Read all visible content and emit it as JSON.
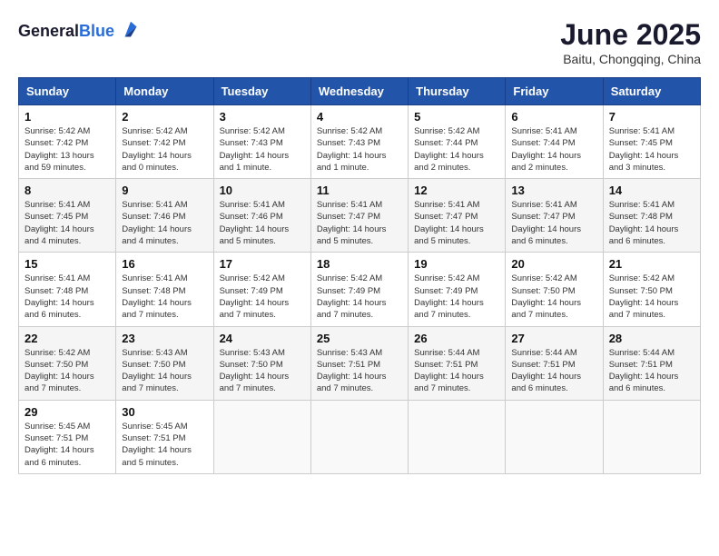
{
  "header": {
    "logo_general": "General",
    "logo_blue": "Blue",
    "month": "June 2025",
    "location": "Baitu, Chongqing, China"
  },
  "weekdays": [
    "Sunday",
    "Monday",
    "Tuesday",
    "Wednesday",
    "Thursday",
    "Friday",
    "Saturday"
  ],
  "weeks": [
    [
      {
        "day": "1",
        "sunrise": "5:42 AM",
        "sunset": "7:42 PM",
        "daylight": "13 hours and 59 minutes."
      },
      {
        "day": "2",
        "sunrise": "5:42 AM",
        "sunset": "7:42 PM",
        "daylight": "14 hours and 0 minutes."
      },
      {
        "day": "3",
        "sunrise": "5:42 AM",
        "sunset": "7:43 PM",
        "daylight": "14 hours and 1 minute."
      },
      {
        "day": "4",
        "sunrise": "5:42 AM",
        "sunset": "7:43 PM",
        "daylight": "14 hours and 1 minute."
      },
      {
        "day": "5",
        "sunrise": "5:42 AM",
        "sunset": "7:44 PM",
        "daylight": "14 hours and 2 minutes."
      },
      {
        "day": "6",
        "sunrise": "5:41 AM",
        "sunset": "7:44 PM",
        "daylight": "14 hours and 2 minutes."
      },
      {
        "day": "7",
        "sunrise": "5:41 AM",
        "sunset": "7:45 PM",
        "daylight": "14 hours and 3 minutes."
      }
    ],
    [
      {
        "day": "8",
        "sunrise": "5:41 AM",
        "sunset": "7:45 PM",
        "daylight": "14 hours and 4 minutes."
      },
      {
        "day": "9",
        "sunrise": "5:41 AM",
        "sunset": "7:46 PM",
        "daylight": "14 hours and 4 minutes."
      },
      {
        "day": "10",
        "sunrise": "5:41 AM",
        "sunset": "7:46 PM",
        "daylight": "14 hours and 5 minutes."
      },
      {
        "day": "11",
        "sunrise": "5:41 AM",
        "sunset": "7:47 PM",
        "daylight": "14 hours and 5 minutes."
      },
      {
        "day": "12",
        "sunrise": "5:41 AM",
        "sunset": "7:47 PM",
        "daylight": "14 hours and 5 minutes."
      },
      {
        "day": "13",
        "sunrise": "5:41 AM",
        "sunset": "7:47 PM",
        "daylight": "14 hours and 6 minutes."
      },
      {
        "day": "14",
        "sunrise": "5:41 AM",
        "sunset": "7:48 PM",
        "daylight": "14 hours and 6 minutes."
      }
    ],
    [
      {
        "day": "15",
        "sunrise": "5:41 AM",
        "sunset": "7:48 PM",
        "daylight": "14 hours and 6 minutes."
      },
      {
        "day": "16",
        "sunrise": "5:41 AM",
        "sunset": "7:48 PM",
        "daylight": "14 hours and 7 minutes."
      },
      {
        "day": "17",
        "sunrise": "5:42 AM",
        "sunset": "7:49 PM",
        "daylight": "14 hours and 7 minutes."
      },
      {
        "day": "18",
        "sunrise": "5:42 AM",
        "sunset": "7:49 PM",
        "daylight": "14 hours and 7 minutes."
      },
      {
        "day": "19",
        "sunrise": "5:42 AM",
        "sunset": "7:49 PM",
        "daylight": "14 hours and 7 minutes."
      },
      {
        "day": "20",
        "sunrise": "5:42 AM",
        "sunset": "7:50 PM",
        "daylight": "14 hours and 7 minutes."
      },
      {
        "day": "21",
        "sunrise": "5:42 AM",
        "sunset": "7:50 PM",
        "daylight": "14 hours and 7 minutes."
      }
    ],
    [
      {
        "day": "22",
        "sunrise": "5:42 AM",
        "sunset": "7:50 PM",
        "daylight": "14 hours and 7 minutes."
      },
      {
        "day": "23",
        "sunrise": "5:43 AM",
        "sunset": "7:50 PM",
        "daylight": "14 hours and 7 minutes."
      },
      {
        "day": "24",
        "sunrise": "5:43 AM",
        "sunset": "7:50 PM",
        "daylight": "14 hours and 7 minutes."
      },
      {
        "day": "25",
        "sunrise": "5:43 AM",
        "sunset": "7:51 PM",
        "daylight": "14 hours and 7 minutes."
      },
      {
        "day": "26",
        "sunrise": "5:44 AM",
        "sunset": "7:51 PM",
        "daylight": "14 hours and 7 minutes."
      },
      {
        "day": "27",
        "sunrise": "5:44 AM",
        "sunset": "7:51 PM",
        "daylight": "14 hours and 6 minutes."
      },
      {
        "day": "28",
        "sunrise": "5:44 AM",
        "sunset": "7:51 PM",
        "daylight": "14 hours and 6 minutes."
      }
    ],
    [
      {
        "day": "29",
        "sunrise": "5:45 AM",
        "sunset": "7:51 PM",
        "daylight": "14 hours and 6 minutes."
      },
      {
        "day": "30",
        "sunrise": "5:45 AM",
        "sunset": "7:51 PM",
        "daylight": "14 hours and 5 minutes."
      },
      null,
      null,
      null,
      null,
      null
    ]
  ],
  "labels": {
    "sunrise": "Sunrise:",
    "sunset": "Sunset:",
    "daylight": "Daylight:"
  }
}
